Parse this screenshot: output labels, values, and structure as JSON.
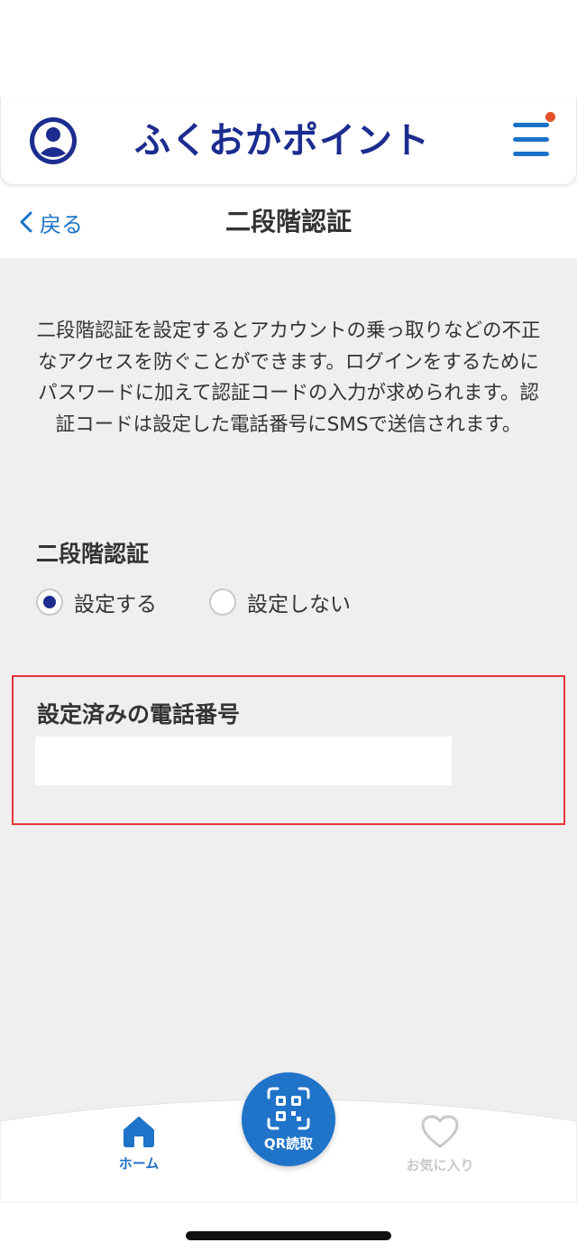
{
  "header": {
    "logo_text": "ふくおかポイント",
    "brand_color": "#1c2d8f",
    "accent_color": "#1a73c8",
    "notification_dot_color": "#e5502a"
  },
  "subnav": {
    "back_label": "戻る",
    "title": "二段階認証"
  },
  "main": {
    "description": "二段階認証を設定するとアカウントの乗っ取りなどの不正なアクセスを防ぐことができます。ログインをするためにパスワードに加えて認証コードの入力が求められます。認証コードは設定した電話番号にSMSで送信されます。",
    "two_factor": {
      "label": "二段階認証",
      "options": [
        {
          "label": "設定する",
          "selected": true
        },
        {
          "label": "設定しない",
          "selected": false
        }
      ]
    },
    "phone": {
      "label": "設定済みの電話番号",
      "value": "",
      "highlight_color": "#e8353a"
    }
  },
  "tabbar": {
    "home_label": "ホーム",
    "qr_label": "QR読取",
    "favorites_label": "お気に入り",
    "active_color": "#1f73c8",
    "inactive_color": "#c8c8c8"
  }
}
